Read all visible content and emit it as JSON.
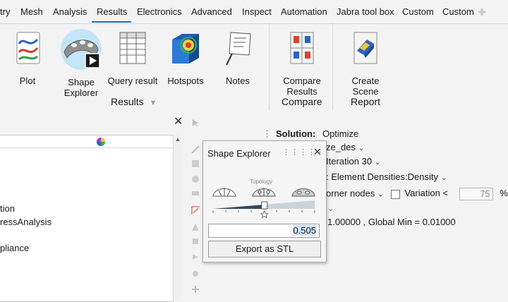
{
  "menu": {
    "items": [
      "try",
      "Mesh",
      "Analysis",
      "Results",
      "Electronics",
      "Advanced",
      "Inspect",
      "Automation",
      "Jabra tool box",
      "Custom",
      "Custom"
    ],
    "active_index": 3,
    "add_icon": "plus-icon"
  },
  "ribbon": {
    "results_group": {
      "label": "Results",
      "tools": {
        "plot": "Plot",
        "shape_explorer_l1": "Shape",
        "shape_explorer_l2": "Explorer",
        "query": "Query result",
        "hotspots": "Hotspots",
        "notes": "Notes"
      }
    },
    "compare_group": {
      "label": "Compare",
      "tools": {
        "compare_l1": "Compare",
        "compare_l2": "Results"
      }
    },
    "report_group": {
      "label": "Report",
      "tools": {
        "scene_l1": "Create",
        "scene_l2": "Scene"
      }
    }
  },
  "tree": {
    "rows": [
      "tion",
      "ressAnalysis",
      "pliance"
    ]
  },
  "properties": {
    "solution_label": "Solution:",
    "solution_value": "Optimize",
    "design_value": "ze_des",
    "iteration_value": "Iteration 30",
    "result_value": ": Element Densities:Density",
    "nodes_value": "orner nodes",
    "variation_label": "Variation <",
    "variation_value": "75",
    "variation_unit": "%",
    "range_text": "1.00000 , Global Min = 0.01000"
  },
  "shape_explorer": {
    "title": "Shape Explorer",
    "slider_label": "Topology",
    "slider_fraction": 0.505,
    "value": "0.505",
    "export_label": "Export as STL"
  },
  "colors": {
    "accent": "#1f6fb5",
    "slider_dark": "#2f4a5a",
    "slider_light": "#c9d3da"
  }
}
